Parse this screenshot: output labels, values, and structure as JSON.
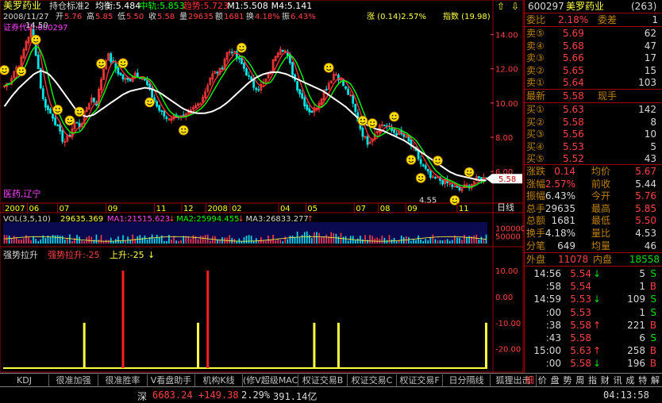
{
  "main": {
    "stock_name": "美罗药业",
    "indicator_name": "持仓标准2",
    "legend": [
      {
        "label": "均衡:5.484",
        "color": "#ffffff"
      },
      {
        "label": "中轨:5.853",
        "color": "#00ff00"
      },
      {
        "label": "趋势:5.723",
        "color": "#ff3030"
      },
      {
        "label": "M1:5.508",
        "color": "#ffffff"
      },
      {
        "label": "M4:5.141",
        "color": "#ffffff"
      }
    ],
    "info_date": "2008/11/27",
    "info_parts": [
      {
        "label": "开",
        "value": "5.76"
      },
      {
        "label": "高",
        "value": "5.85"
      },
      {
        "label": "低",
        "value": "5.50"
      },
      {
        "label": "收",
        "value": "5.58"
      },
      {
        "label": "量",
        "value": "29635"
      },
      {
        "label": "额",
        "value": "1681"
      },
      {
        "label": "换",
        "value": "4.18%"
      },
      {
        "label": "振",
        "value": "6.43%"
      }
    ],
    "info_change": "涨 (0.14)2.57%",
    "info_index": "指数 (19.98)",
    "code_label": "证券代码:600297",
    "sector_label": "医药,辽宁",
    "high_marker": "14.50",
    "low_marker": "4.55",
    "price_tag": "5.58",
    "period_label": "日线"
  },
  "chart_data": [
    {
      "type": "candlestick",
      "title": "",
      "y_ticks": [
        6.0,
        8.0,
        10.0,
        12.0,
        14.0
      ],
      "ylim": [
        4.2,
        15.0
      ],
      "x_ticks": [
        "2007",
        "06",
        "07",
        "09",
        "11",
        "12",
        "2008",
        "02",
        "04",
        "05",
        "07",
        "08",
        "09",
        "11"
      ],
      "x_tick_index": [
        0,
        8,
        18,
        34,
        50,
        59,
        67,
        75,
        91,
        100,
        116,
        124,
        133,
        150
      ],
      "close_path": [
        11.0,
        11.3,
        12.0,
        12.4,
        13.6,
        14.3,
        12.6,
        10.3,
        9.6,
        9.2,
        8.4,
        7.7,
        8.1,
        8.9,
        8.6,
        9.6,
        10.3,
        10.0,
        11.6,
        12.9,
        12.3,
        11.8,
        11.4,
        11.3,
        11.8,
        11.6,
        11.3,
        10.6,
        9.9,
        9.4,
        9.1,
        9.2,
        9.3,
        9.1,
        9.3,
        9.7,
        10.0,
        10.6,
        11.5,
        11.8,
        11.9,
        12.9,
        13.1,
        12.6,
        12.2,
        11.6,
        11.0,
        10.9,
        11.2,
        11.7,
        12.8,
        13.3,
        13.0,
        12.0,
        11.0,
        10.3,
        9.6,
        9.5,
        10.0,
        10.7,
        11.2,
        11.8,
        11.4,
        10.8,
        10.3,
        9.3,
        8.3,
        7.7,
        8.0,
        8.6,
        8.8,
        8.5,
        8.3,
        8.2,
        8.0,
        7.6,
        7.1,
        6.4,
        6.0,
        5.5,
        5.6,
        5.4,
        5.3,
        5.1,
        4.9,
        5.1,
        5.2,
        5.5,
        5.6,
        5.58
      ],
      "ma_white": [
        9.8,
        10.4,
        10.9,
        11.3,
        11.7,
        11.9,
        11.7,
        11.2,
        10.6,
        10.0,
        9.4,
        9.2,
        9.3,
        9.6,
        9.9,
        10.2,
        10.5,
        10.7,
        10.8,
        10.9,
        10.8,
        10.6,
        10.3,
        10.0,
        9.7,
        9.5,
        9.4,
        9.4,
        9.5,
        9.7,
        10.0,
        10.4,
        10.8,
        11.2,
        11.5,
        11.7,
        11.8,
        11.8,
        11.7,
        11.5,
        11.3,
        11.1,
        10.9,
        10.7,
        10.4,
        10.1,
        9.8,
        9.4,
        9.0,
        8.7,
        8.5,
        8.4,
        8.2,
        8.0,
        7.8,
        7.5,
        7.2,
        6.9,
        6.6,
        6.3,
        6.0,
        5.8,
        5.7,
        5.6,
        5.5,
        5.48
      ],
      "markers_index": [
        0,
        3,
        6,
        10,
        12,
        14,
        18,
        22,
        27,
        33,
        44,
        60,
        66,
        68,
        72,
        75,
        77,
        80,
        83,
        86
      ]
    },
    {
      "type": "bar",
      "title": "VOL(3,5,10)",
      "series": [
        {
          "name": "VOL",
          "value": "29635.369"
        },
        {
          "name": "MA1",
          "value": "21515.623"
        },
        {
          "name": "MA2",
          "value": "25994.455"
        },
        {
          "name": "MA3",
          "value": "26833.277"
        }
      ],
      "y_ticks": [
        100000,
        50000
      ],
      "ylim": [
        0,
        140000
      ]
    },
    {
      "type": "bar",
      "title": "强势拉升",
      "series": [
        {
          "name": "强势拉升",
          "value": "-25"
        },
        {
          "name": "上升",
          "value": "-25"
        }
      ],
      "y_ticks": [
        10.0,
        0.0,
        -10.0,
        -20.0
      ],
      "ylim": [
        -28,
        14
      ],
      "spikes": [
        {
          "index": 33,
          "color": "yellow",
          "value": -10
        },
        {
          "index": 49,
          "color": "red",
          "value": 10
        },
        {
          "index": 80,
          "color": "yellow",
          "value": -10
        },
        {
          "index": 84,
          "color": "red",
          "value": 10
        },
        {
          "index": 128,
          "color": "yellow",
          "value": -10
        },
        {
          "index": 138,
          "color": "yellow",
          "value": -10
        },
        {
          "index": 199,
          "color": "yellow",
          "value": -10
        }
      ]
    }
  ],
  "side": {
    "code": "600297",
    "name": "美罗药业",
    "num": "(263)",
    "weibi_label": "委比",
    "weibi_value": "2.18%",
    "weicha_label": "委差",
    "weicha_value": "1",
    "sells": [
      {
        "label": "卖⑤",
        "price": "5.69",
        "vol": "62"
      },
      {
        "label": "卖④",
        "price": "5.68",
        "vol": "47"
      },
      {
        "label": "卖③",
        "price": "5.66",
        "vol": "17"
      },
      {
        "label": "卖②",
        "price": "5.65",
        "vol": "15"
      },
      {
        "label": "卖①",
        "price": "5.64",
        "vol": "103"
      }
    ],
    "latest_label": "最新",
    "latest_value": "5.58",
    "xianshou_label": "现手",
    "buys": [
      {
        "label": "买①",
        "price": "5.63",
        "vol": "142"
      },
      {
        "label": "买②",
        "price": "5.58",
        "vol": "8"
      },
      {
        "label": "买③",
        "price": "5.56",
        "vol": "10"
      },
      {
        "label": "买④",
        "price": "5.53",
        "vol": "5"
      },
      {
        "label": "买⑤",
        "price": "5.52",
        "vol": "43"
      }
    ],
    "stats": [
      {
        "l1": "涨跌",
        "v1": "0.14",
        "c1": "red",
        "l2": "均价",
        "v2": "5.67",
        "c2": "red"
      },
      {
        "l1": "涨幅",
        "v1": "2.57%",
        "c1": "red",
        "l2": "前收",
        "v2": "5.44",
        "c2": "wht"
      },
      {
        "l1": "振幅",
        "v1": "6.43%",
        "c1": "wht",
        "l2": "今开",
        "v2": "5.76",
        "c2": "red"
      },
      {
        "l1": "总手",
        "v1": "29635",
        "c1": "wht",
        "l2": "最高",
        "v2": "5.85",
        "c2": "red"
      },
      {
        "l1": "总额",
        "v1": "1681",
        "c1": "wht",
        "l2": "最低",
        "v2": "5.50",
        "c2": "red"
      },
      {
        "l1": "换手",
        "v1": "4.18%",
        "c1": "wht",
        "l2": "量比",
        "v2": "4.53",
        "c2": "wht"
      },
      {
        "l1": "分笔",
        "v1": "649",
        "c1": "wht",
        "l2": "均量",
        "v2": "46",
        "c2": "wht"
      }
    ],
    "waipan_label": "外盘",
    "waipan_value": "11078",
    "neipan_label": "内盘",
    "neipan_value": "18558",
    "ticks": [
      {
        "time": "14:56",
        "price": "5.54",
        "arrow": "↓",
        "vol": "5",
        "side": "S",
        "pc": "red",
        "ac": "grn",
        "sc": "grn"
      },
      {
        "time": ":58",
        "price": "5.54",
        "arrow": "",
        "vol": "1",
        "side": "B",
        "pc": "red",
        "ac": "grn",
        "sc": "red"
      },
      {
        "time": "14:59",
        "price": "5.53",
        "arrow": "↓",
        "vol": "109",
        "side": "S",
        "pc": "red",
        "ac": "grn",
        "sc": "grn"
      },
      {
        "time": ":00",
        "price": "5.53",
        "arrow": "",
        "vol": "1",
        "side": "S",
        "pc": "red",
        "ac": "grn",
        "sc": "grn"
      },
      {
        "time": ":38",
        "price": "5.58",
        "arrow": "↑",
        "vol": "221",
        "side": "B",
        "pc": "red",
        "ac": "red",
        "sc": "red"
      },
      {
        "time": ":43",
        "price": "5.58",
        "arrow": "",
        "vol": "6",
        "side": "S",
        "pc": "red",
        "ac": "grn",
        "sc": "grn"
      },
      {
        "time": "15:00",
        "price": "5.63",
        "arrow": "↑",
        "vol": "258",
        "side": "B",
        "pc": "red",
        "ac": "red",
        "sc": "red"
      },
      {
        "time": ":00",
        "price": "5.58",
        "arrow": "↓",
        "vol": "196",
        "side": "B",
        "pc": "red",
        "ac": "grn",
        "sc": "red"
      }
    ]
  },
  "tabs": [
    {
      "label": "KDJ"
    },
    {
      "label": "很准加强"
    },
    {
      "label": "很准胜率"
    },
    {
      "label": "V看盘助手"
    },
    {
      "label": "机构K线"
    },
    {
      "label": "(修V超级MACD"
    },
    {
      "label": "权证交易B"
    },
    {
      "label": "权证交易C"
    },
    {
      "label": "权证交易F"
    },
    {
      "label": "日分隔线"
    },
    {
      "label": "狐狸出击"
    }
  ],
  "right_tabs": [
    {
      "label": "细"
    },
    {
      "label": "价"
    },
    {
      "label": "盘"
    },
    {
      "label": "势"
    },
    {
      "label": "周"
    },
    {
      "label": "指"
    },
    {
      "label": "财"
    },
    {
      "label": "讯"
    },
    {
      "label": "成"
    },
    {
      "label": "特"
    },
    {
      "label": "解"
    }
  ],
  "status": {
    "index_name": "深",
    "index_value": "6683.24",
    "index_change": "+149.38",
    "index_pct": "2.29%",
    "turnover": "391.14亿",
    "time": "04:13:58"
  },
  "colors": {
    "up": "#ff3c3c",
    "down": "#00e4e4",
    "frame": "#a00000",
    "ma_white": "#ffffff",
    "ma_green": "#00ff00",
    "ma_red": "#ff3030",
    "yellow": "#ffff00"
  }
}
